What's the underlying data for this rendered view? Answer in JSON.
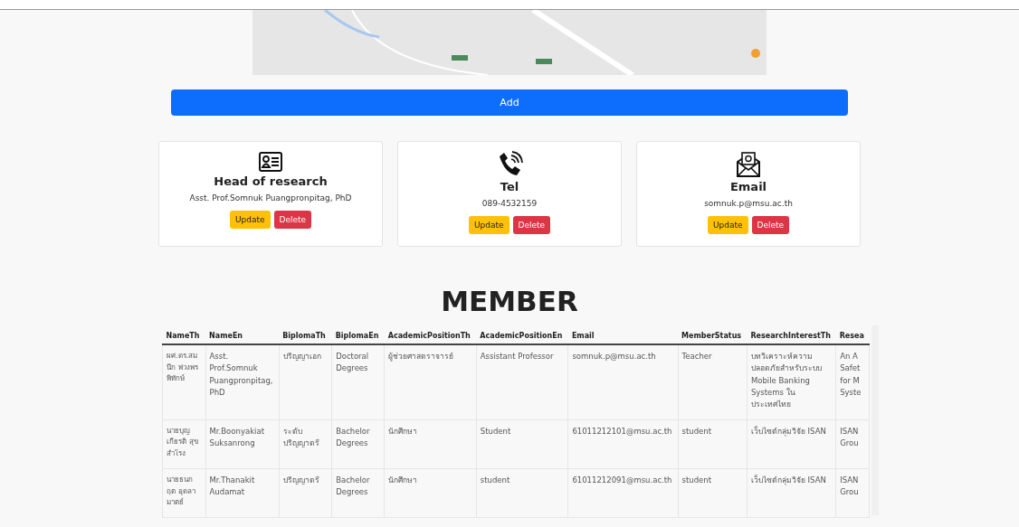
{
  "add_button": {
    "label": "Add"
  },
  "cards": [
    {
      "kind": "person",
      "title": "Head of research",
      "value": "Asst. Prof.Somnuk Puangpronpitag, PhD",
      "buttons": [
        "Update",
        "Delete"
      ]
    },
    {
      "kind": "phone",
      "title": "Tel",
      "value": "089-4532159",
      "buttons": [
        "Update",
        "Delete"
      ]
    },
    {
      "kind": "email",
      "title": "Email",
      "value": "somnuk.p@msu.ac.th",
      "buttons": [
        "Update",
        "Delete"
      ]
    }
  ],
  "member_heading": "MEMBER",
  "table": {
    "columns": [
      "NameTh",
      "NameEn",
      "BiplomaTh",
      "BiplomaEn",
      "AcademicPositionTh",
      "AcademicPositionEn",
      "Email",
      "MemberStatus",
      "ResearchInterestTh",
      "Resea"
    ],
    "rows": [
      [
        "ผศ.ดร.สมนึก พ่วงพรพิทักษ์",
        "Asst. Prof.Somnuk Puangpronpitag, PhD",
        "ปริญญาเอก",
        "Doctoral Degrees",
        "ผู้ช่วยศาสตราจารย์",
        "Assistant Professor",
        "somnuk.p@msu.ac.th",
        "Teacher",
        "บทวิเคราะห์ความปลอดภัยสำหรับระบบ Mobile Banking Systems ใน ประเทศไทย",
        "An A Safet for M Syste"
      ],
      [
        "นายบุญเกียรติ สุขสำโรง",
        "Mr.Boonyakiat Suksanrong",
        "ระดับ ปริญญาตรี",
        "Bachelor Degrees",
        "นักศึกษา",
        "Student",
        "61011212101@msu.ac.th",
        "student",
        "เว็บไซต์กลุ่มวิจัย ISAN",
        "ISAN Grou"
      ],
      [
        "นายธนกฤต อุดลามาตย์",
        "Mr.Thanakit Audamat",
        "ปริญญาตรี",
        "Bachelor Degrees",
        "นักศึกษา",
        "student",
        "61011212091@msu.ac.th",
        "student",
        "เว็บไซต์กลุ่มวิจัย ISAN",
        "ISAN Grou"
      ]
    ]
  }
}
